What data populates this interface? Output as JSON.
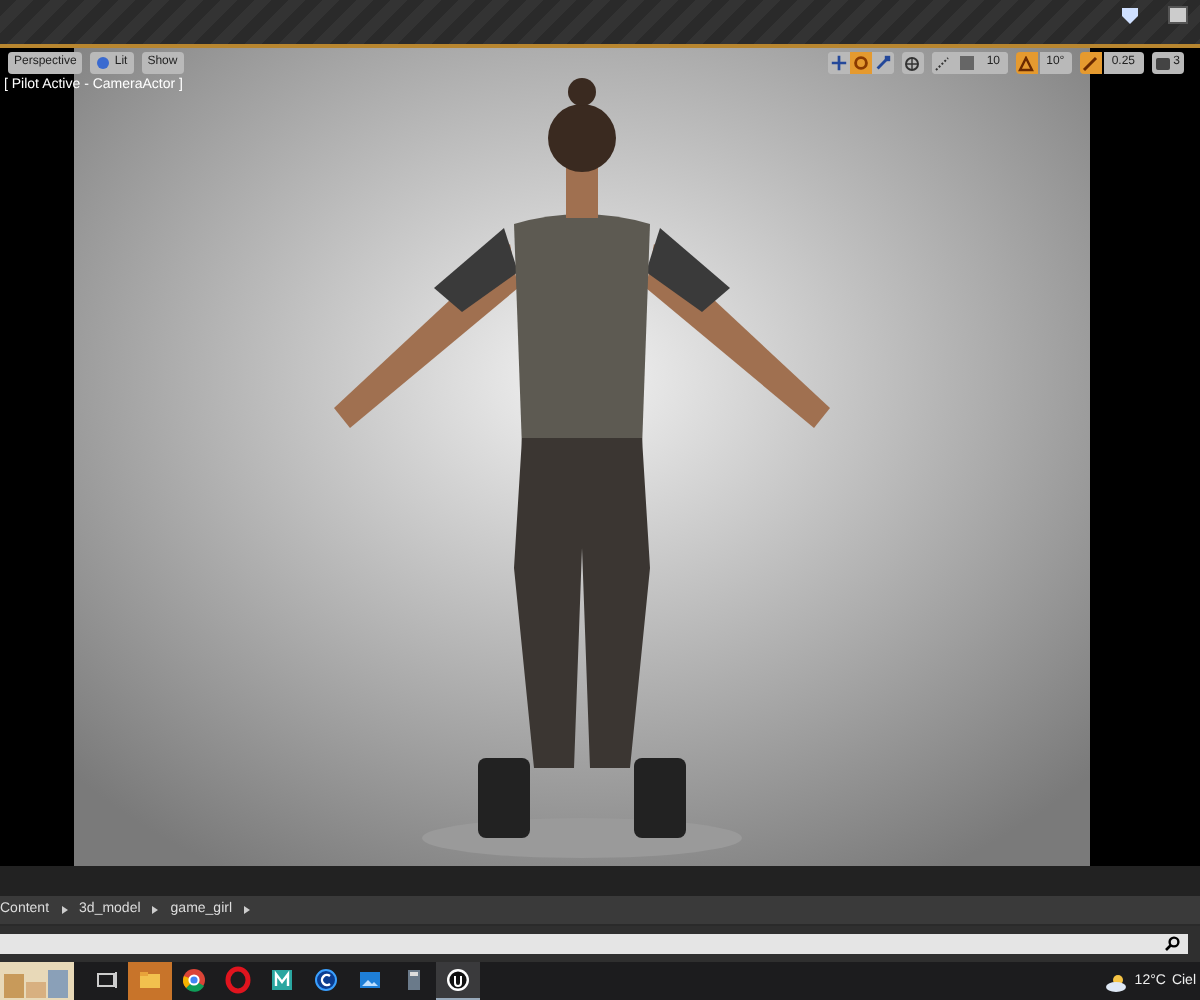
{
  "viewport": {
    "view_mode": "Perspective",
    "lighting": "Lit",
    "show": "Show",
    "pilot_label": "[ Pilot Active - CameraActor ]",
    "transform_tools": [
      {
        "kind": "translate",
        "selected": false
      },
      {
        "kind": "rotate",
        "selected": true
      },
      {
        "kind": "scale",
        "selected": false
      }
    ],
    "grid_snap": "10",
    "rotation_snap": "10°",
    "scale_snap": "0.25",
    "camera_speed": "3"
  },
  "breadcrumb": [
    "Content",
    "3d_model",
    "game_girl"
  ],
  "taskbar": {
    "apps": [
      {
        "kind": "task-view",
        "flashing": false,
        "active": false
      },
      {
        "kind": "folder",
        "flashing": true,
        "active": false
      },
      {
        "kind": "chrome",
        "flashing": false,
        "active": false
      },
      {
        "kind": "opera",
        "flashing": false,
        "active": false
      },
      {
        "kind": "m",
        "flashing": false,
        "active": false
      },
      {
        "kind": "c",
        "flashing": false,
        "active": false
      },
      {
        "kind": "photos",
        "flashing": false,
        "active": false
      },
      {
        "kind": "calculator",
        "flashing": false,
        "active": false
      },
      {
        "kind": "unreal",
        "flashing": false,
        "active": true
      }
    ],
    "temperature": "12°C",
    "condition": "Ciel"
  }
}
